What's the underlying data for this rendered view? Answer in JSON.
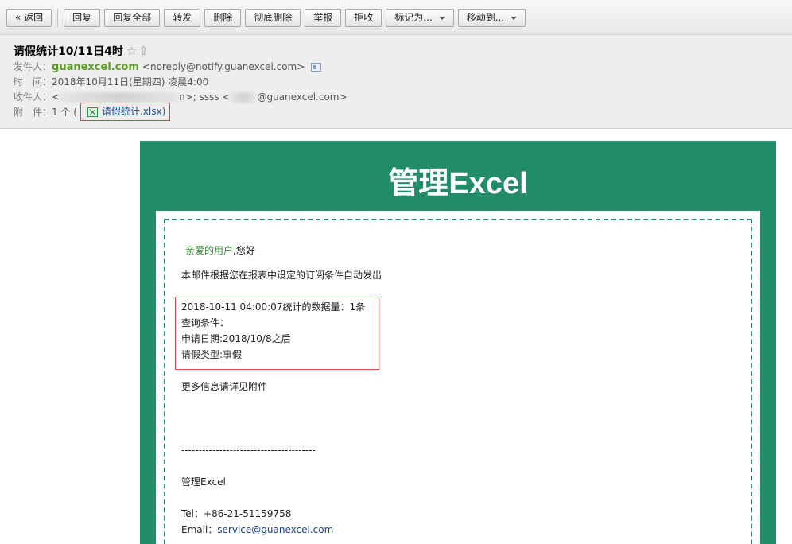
{
  "toolbar": {
    "back": "« 返回",
    "reply": "回复",
    "reply_all": "回复全部",
    "forward": "转发",
    "delete": "删除",
    "delete_permanent": "彻底删除",
    "report": "举报",
    "reject": "拒收",
    "mark_as": "标记为...",
    "move_to": "移动到..."
  },
  "header": {
    "subject": "请假统计10/11日4时",
    "from_label": "发件人：",
    "from_name": "guanexcel.com",
    "from_email": "<noreply@notify.guanexcel.com>",
    "time_label": "时　间：",
    "time_value": "2018年10月11日(星期四) 凌晨4:00",
    "to_label": "收件人：",
    "to_part1": "<",
    "to_part2": "n>; ssss <",
    "to_part3": "@guanexcel.com>",
    "attach_label": "附　件：",
    "attach_count": "1 个 (",
    "attach_name": "请假统计.xlsx",
    "attach_close": ")"
  },
  "email": {
    "brand_title": "管理Excel",
    "greeting_name": "亲爱的用户",
    "greeting_rest": ",您好",
    "intro": "本邮件根据您在报表中设定的订阅条件自动发出",
    "stat_line": "2018-10-11 04:00:07统计的数据量：1条",
    "query_label": "查询条件：",
    "apply_date": "申请日期:2018/10/8之后",
    "leave_type": "请假类型:事假",
    "more_info": "更多信息请详见附件",
    "divider": "---------------------------------------",
    "signature": "管理Excel",
    "tel": "Tel：+86-21-51159758",
    "email_label": "Email：",
    "email_value": "service@guanexcel.com"
  }
}
